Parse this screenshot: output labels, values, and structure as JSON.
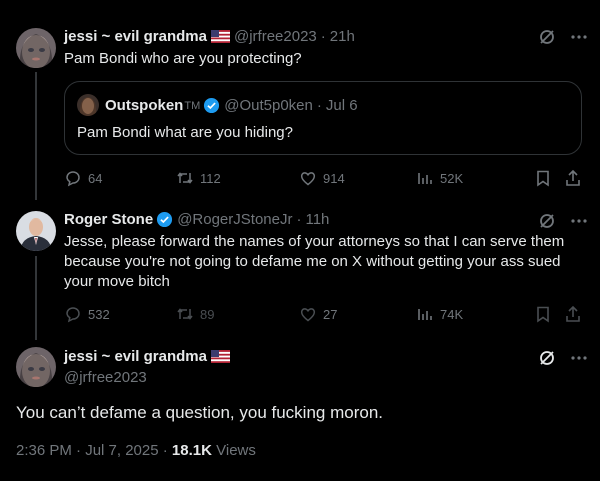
{
  "tweet1": {
    "name": "jessi ~ evil grandma",
    "handle": "@jrfree2023",
    "time": "21h",
    "text": "Pam Bondi who are you protecting?",
    "quote": {
      "name": "Outspoken",
      "tm": "TM",
      "handle": "@Out5p0ken",
      "time": "Jul 6",
      "text": "Pam Bondi what are you hiding?"
    },
    "stats": {
      "replies": "64",
      "retweets": "112",
      "likes": "914",
      "views": "52K"
    }
  },
  "tweet2": {
    "name": "Roger Stone",
    "handle": "@RogerJStoneJr",
    "time": "11h",
    "text_lines": [
      "Jesse, please forward the names of your attorneys so that I can serve them",
      "because you're not going to defame me on X without getting your ass sued",
      "your move bitch"
    ],
    "stats": {
      "replies": "532",
      "retweets": "89",
      "likes": "27",
      "views": "74K"
    }
  },
  "tweet3": {
    "name": "jessi ~ evil grandma",
    "handle": "@jrfree2023",
    "text": "You can’t defame a question, you fucking moron.",
    "date": "2:36 PM · Jul 7, 2025 ·",
    "views_count": "18.1K",
    "views_label": "Views"
  },
  "colors": {
    "background": "#000000",
    "text": "#e7e9ea",
    "muted": "#71767b",
    "verified": "#1d9bf0",
    "border": "#2f3336"
  },
  "icons": [
    "grok-icon",
    "more-icon",
    "reply-icon",
    "retweet-icon",
    "like-icon",
    "views-icon",
    "bookmark-icon",
    "share-icon",
    "verified-icon",
    "us-flag-icon"
  ]
}
